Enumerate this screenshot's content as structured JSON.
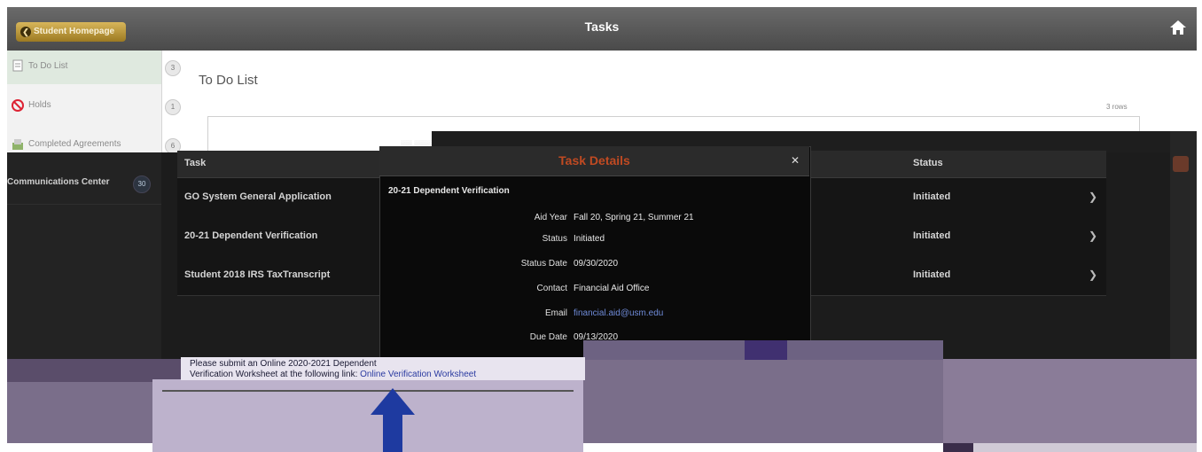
{
  "header": {
    "back_label": "Student Homepage",
    "title": "Tasks"
  },
  "sidebar": {
    "items": [
      {
        "label": "To Do List",
        "count": "3"
      },
      {
        "label": "Holds",
        "count": "1"
      },
      {
        "label": "Completed Agreements",
        "count": "6"
      }
    ],
    "communications_label": "Communications Center",
    "communications_count": "30"
  },
  "main": {
    "page_title": "To Do List",
    "rows_label": "3 rows"
  },
  "table": {
    "headers": {
      "task": "Task",
      "status": "Status"
    },
    "rows": [
      {
        "task": "GO System General Application",
        "status": "Initiated"
      },
      {
        "task": "20-21 Dependent Verification",
        "status": "Initiated"
      },
      {
        "task": "Student 2018 IRS TaxTranscript",
        "status": "Initiated"
      }
    ]
  },
  "dialog": {
    "title": "Task Details",
    "subtitle": "20-21 Dependent Verification",
    "fields": [
      {
        "label": "Aid Year",
        "value": "Fall 20, Spring 21, Summer 21"
      },
      {
        "label": "Status",
        "value": "Initiated"
      },
      {
        "label": "Status Date",
        "value": "09/30/2020"
      },
      {
        "label": "Contact",
        "value": "Financial Aid Office"
      },
      {
        "label": "Email",
        "value": "financial.aid@usm.edu"
      },
      {
        "label": "Due Date",
        "value": "09/13/2020"
      }
    ]
  },
  "bottom": {
    "text": "Please submit an Online 2020-2021 Dependent",
    "text2": "Verification Worksheet at the following link:",
    "link": "Online Verification Worksheet"
  },
  "colors": {
    "header_bg": "#5a5a5a",
    "back_button": "#c9a84a",
    "dialog_title": "#c04a22",
    "arrow": "#1e3aa0"
  }
}
